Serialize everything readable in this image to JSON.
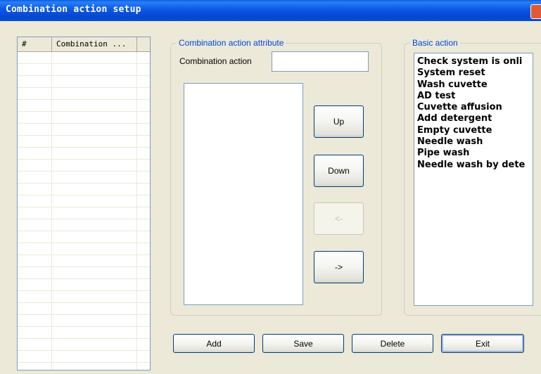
{
  "window": {
    "title": "Combination action setup"
  },
  "grid": {
    "columns": [
      "#",
      "Combination ..."
    ]
  },
  "attribute_group": {
    "legend": "Combination action attribute",
    "combination_label": "Combination action",
    "combination_value": ""
  },
  "buttons": {
    "up": "Up",
    "down": "Down",
    "left": "<-",
    "right": "->"
  },
  "basic_group": {
    "legend": "Basic action",
    "items": [
      "Check system is onli",
      "System reset",
      "Wash cuvette",
      "AD test",
      "Cuvette affusion",
      "Add detergent",
      "Empty cuvette",
      "Needle wash",
      "Pipe wash",
      "Needle wash by dete"
    ]
  },
  "footer": {
    "add": "Add",
    "save": "Save",
    "delete": "Delete",
    "exit": "Exit"
  }
}
